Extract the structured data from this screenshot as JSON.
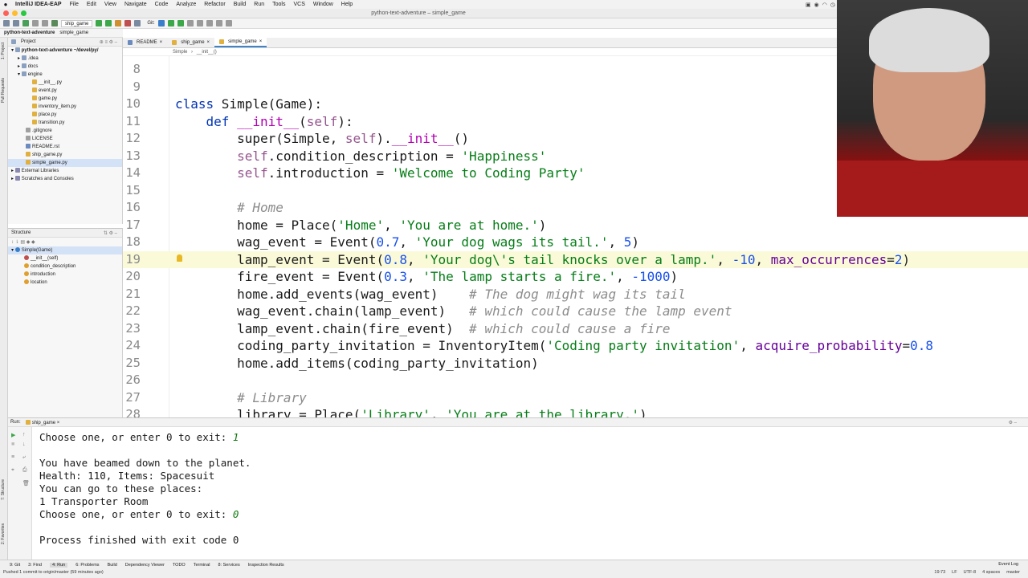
{
  "menubar": {
    "app": "IntelliJ IDEA-EAP",
    "items": [
      "File",
      "Edit",
      "View",
      "Navigate",
      "Code",
      "Analyze",
      "Refactor",
      "Build",
      "Run",
      "Tools",
      "VCS",
      "Window",
      "Help"
    ]
  },
  "window": {
    "title": "python-text-adventure – simple_game"
  },
  "toolbar": {
    "run_config": "ship_game",
    "git_label": "Git:"
  },
  "breadcrumb": {
    "project": "python-text-adventure",
    "file": "simple_game"
  },
  "project_panel": {
    "title": "Project",
    "items": [
      "python-text-adventure ~/devel/py/",
      ".idea",
      "docs",
      "engine",
      "__init__.py",
      "event.py",
      "game.py",
      "inventory_item.py",
      "place.py",
      "transition.py",
      ".gitignore",
      "LICENSE",
      "README.rst",
      "ship_game.py",
      "simple_game.py",
      "External Libraries",
      "Scratches and Consoles"
    ]
  },
  "structure_panel": {
    "title": "Structure",
    "items": [
      "Simple(Game)",
      "__init__(self)",
      "condition_description",
      "introduction",
      "location"
    ]
  },
  "left_stripe": {
    "project": "1: Project",
    "pull_requests": "Pull Requests",
    "structure": "7: Structure",
    "favorites": "2: Favorites"
  },
  "editor": {
    "tabs": [
      "README",
      "ship_game",
      "simple_game"
    ],
    "crumb_class": "Simple",
    "crumb_method": "__init__()",
    "line_numbers": [
      "8",
      "9",
      "10",
      "11",
      "12",
      "13",
      "14",
      "15",
      "16",
      "17",
      "18",
      "19",
      "20",
      "21",
      "22",
      "23",
      "24",
      "25",
      "26",
      "27",
      "28"
    ],
    "code": {
      "l10": {
        "kw": "class",
        "rest": " Simple(Game):"
      },
      "l11": {
        "kw": "def",
        "name": "__init__",
        "open": "(",
        "self": "self",
        "close": "):"
      },
      "l12": {
        "a": "super(Simple, ",
        "self": "self",
        "b": ").",
        "dunder": "__init__",
        "c": "()"
      },
      "l13": {
        "self": "self",
        "a": ".condition_description = ",
        "str": "'Happiness'"
      },
      "l14": {
        "self": "self",
        "a": ".introduction = ",
        "str": "'Welcome to Coding Party'"
      },
      "l16": {
        "cm": "# Home"
      },
      "l17": {
        "a": "home = Place(",
        "s1": "'Home'",
        "b": ", ",
        "s2": "'You are at home.'",
        "c": ")"
      },
      "l18": {
        "a": "wag_event = Event(",
        "n1": "0.7",
        "b": ", ",
        "s1": "'Your dog wags its tail.'",
        "c": ", ",
        "n2": "5",
        "d": ")"
      },
      "l19": {
        "a": "lamp_event = Event(",
        "n1": "0.8",
        "b": ", ",
        "s1": "'Your dog\\'s tail knocks over a lamp.'",
        "c": ", ",
        "n2": "-10",
        "d": ", ",
        "p": "max_occurrences",
        "e": "=",
        "n3": "2",
        "f": ")"
      },
      "l20": {
        "a": "fire_event = Event(",
        "n1": "0.3",
        "b": ", ",
        "s1": "'The lamp starts a fire.'",
        "c": ", ",
        "n2": "-1000",
        "d": ")"
      },
      "l21": {
        "a": "home.add_events(wag_event)    ",
        "cm": "# The dog might wag its tail"
      },
      "l22": {
        "a": "wag_event.chain(lamp_event)   ",
        "cm": "# which could cause the lamp event"
      },
      "l23": {
        "a": "lamp_event.chain(fire_event)  ",
        "cm": "# which could cause a fire"
      },
      "l24": {
        "a": "coding_party_invitation = InventoryItem(",
        "s1": "'Coding party invitation'",
        "b": ", ",
        "p": "acquire_probability",
        "c": "=",
        "n1": "0.8"
      },
      "l25": {
        "a": "home.add_items(coding_party_invitation)"
      },
      "l27": {
        "cm": "# Library"
      },
      "l28": {
        "a": "library = Place(",
        "s1": "'Library'",
        "b": ", ",
        "s2": "'You are at the library.'",
        "c": ")"
      }
    }
  },
  "run_panel": {
    "label": "Run:",
    "config": "ship_game",
    "console": {
      "l1": "Choose one, or enter 0 to exit: ",
      "l1_input": "1",
      "l3": "You have beamed down to the planet.",
      "l4": "Health: 110, Items: Spacesuit",
      "l5": "You can go to these places:",
      "l6": "1 Transporter Room",
      "l7": "Choose one, or enter 0 to exit: ",
      "l7_input": "0",
      "l9": "Process finished with exit code 0"
    }
  },
  "statusbar": {
    "tool_tabs": [
      "9: Git",
      "3: Find",
      "4: Run",
      "6: Problems",
      "Build",
      "Dependency Viewer",
      "TODO",
      "Terminal",
      "8: Services",
      "Inspection Results"
    ],
    "event_log": "Event Log",
    "message": "Pushed 1 commit to origin/master (59 minutes ago)",
    "position": "19:73",
    "line_sep": "LF",
    "encoding": "UTF-8",
    "indent": "4 spaces",
    "branch": "master"
  },
  "colors": {
    "keyword": "#0033b3",
    "self": "#94558d",
    "string": "#067d17",
    "number": "#1750eb",
    "comment": "#8c8c8c",
    "dunder": "#b200b2"
  }
}
